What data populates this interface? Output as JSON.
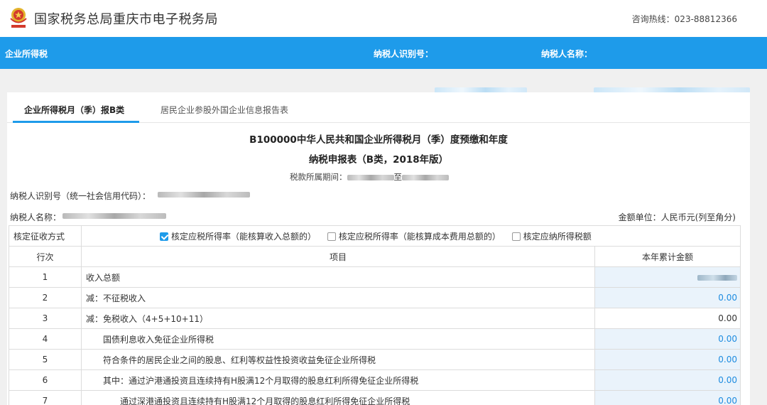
{
  "header": {
    "site_title": "国家税务总局重庆市电子税务局",
    "hotline": "咨询热线：023-88812366"
  },
  "navbar": {
    "title": "企业所得税",
    "taxpayer_id_label": "纳税人识别号：",
    "taxpayer_name_label": "纳税人名称："
  },
  "tabs": [
    {
      "label": "企业所得税月（季）报B类",
      "active": true
    },
    {
      "label": "居民企业参股外国企业信息报告表",
      "active": false
    }
  ],
  "form": {
    "title_line1": "B100000中华人民共和国企业所得税月（季）度预缴和年度",
    "title_line2": "纳税申报表（B类，2018年版）",
    "period_label": "税款所属期间：",
    "period_to": "至",
    "credit_code_label": "纳税人识别号（统一社会信用代码）：",
    "name_label": "纳税人名称：",
    "unit_note": "金额单位：人民币元(列至角分)"
  },
  "levy_method": {
    "label": "核定征收方式",
    "options": [
      {
        "label": "核定应税所得率（能核算收入总额的）",
        "checked": true
      },
      {
        "label": "核定应税所得率（能核算成本费用总额的）",
        "checked": false
      },
      {
        "label": "核定应纳所得税额",
        "checked": false
      }
    ]
  },
  "table": {
    "headers": {
      "row_no": "行次",
      "item": "项目",
      "amount": "本年累计金额"
    },
    "rows": [
      {
        "no": "1",
        "item": "收入总额",
        "amount": ""
      },
      {
        "no": "2",
        "item": "减：不征税收入",
        "amount": "0.00"
      },
      {
        "no": "3",
        "item": "减：免税收入（4+5+10+11）",
        "amount": "0.00"
      },
      {
        "no": "4",
        "item": "国债利息收入免征企业所得税",
        "amount": "0.00"
      },
      {
        "no": "5",
        "item": "符合条件的居民企业之间的股息、红利等权益性投资收益免征企业所得税",
        "amount": "0.00"
      },
      {
        "no": "6",
        "item": "其中：通过沪港通投资且连续持有H股满12个月取得的股息红利所得免征企业所得税",
        "amount": "0.00"
      },
      {
        "no": "7",
        "item": "通过深港通投资且连续持有H股满12个月取得的股息红利所得免征企业所得税",
        "amount": "0.00"
      }
    ]
  },
  "colors": {
    "brand_blue": "#1e9bea",
    "amount_blue": "#1e8ce0",
    "cell_tint": "#eaf3fb"
  }
}
